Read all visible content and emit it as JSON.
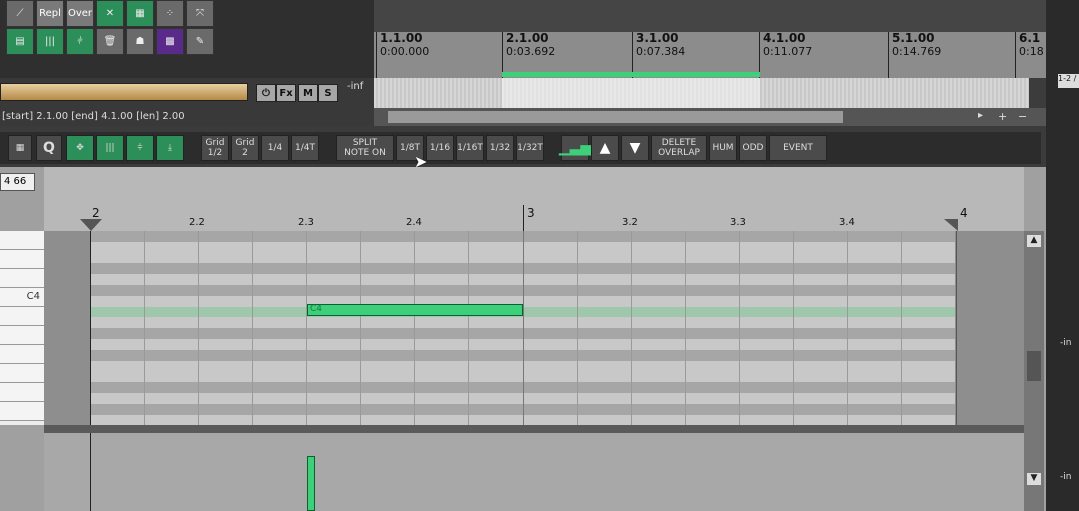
{
  "toolbar": {
    "repl_label": "Repl",
    "over_label": "Over"
  },
  "track": {
    "fx_label": "Fx",
    "m_label": "M",
    "s_label": "S",
    "volume_readout": "-inf"
  },
  "status_text": "[start] 2.1.00 [end] 4.1.00 [len] 2.00",
  "ruler": {
    "marks": [
      {
        "bar": "1.1.00",
        "time": "0:00.000"
      },
      {
        "bar": "2.1.00",
        "time": "0:03.692"
      },
      {
        "bar": "3.1.00",
        "time": "0:07.384"
      },
      {
        "bar": "4.1.00",
        "time": "0:11.077"
      },
      {
        "bar": "5.1.00",
        "time": "0:14.769"
      },
      {
        "bar": "6.1",
        "time": "0:18"
      }
    ]
  },
  "midi_toolbar": {
    "grid_half": "Grid\n1/2",
    "grid_2": "Grid\n2",
    "q14": "1/4",
    "q14t": "1/4T",
    "split": "SPLIT\nNOTE ON",
    "q18t": "1/8T",
    "q116": "1/16",
    "q116t": "1/16T",
    "q132": "1/32",
    "q132t": "1/32T",
    "delete_overlap": "DELETE\nOVERLAP",
    "hum": "HUM",
    "odd": "ODD",
    "event": "EVENT"
  },
  "editor": {
    "field_value": "4  66",
    "key_label": "C4",
    "note_label": "C4",
    "bar_labels": [
      "2",
      "2.2",
      "2.3",
      "2.4",
      "3",
      "3.2",
      "3.3",
      "3.4",
      "4"
    ]
  },
  "rpanel": {
    "route_label": "1-2 /",
    "inf1": "-in",
    "inf2": "-in"
  }
}
